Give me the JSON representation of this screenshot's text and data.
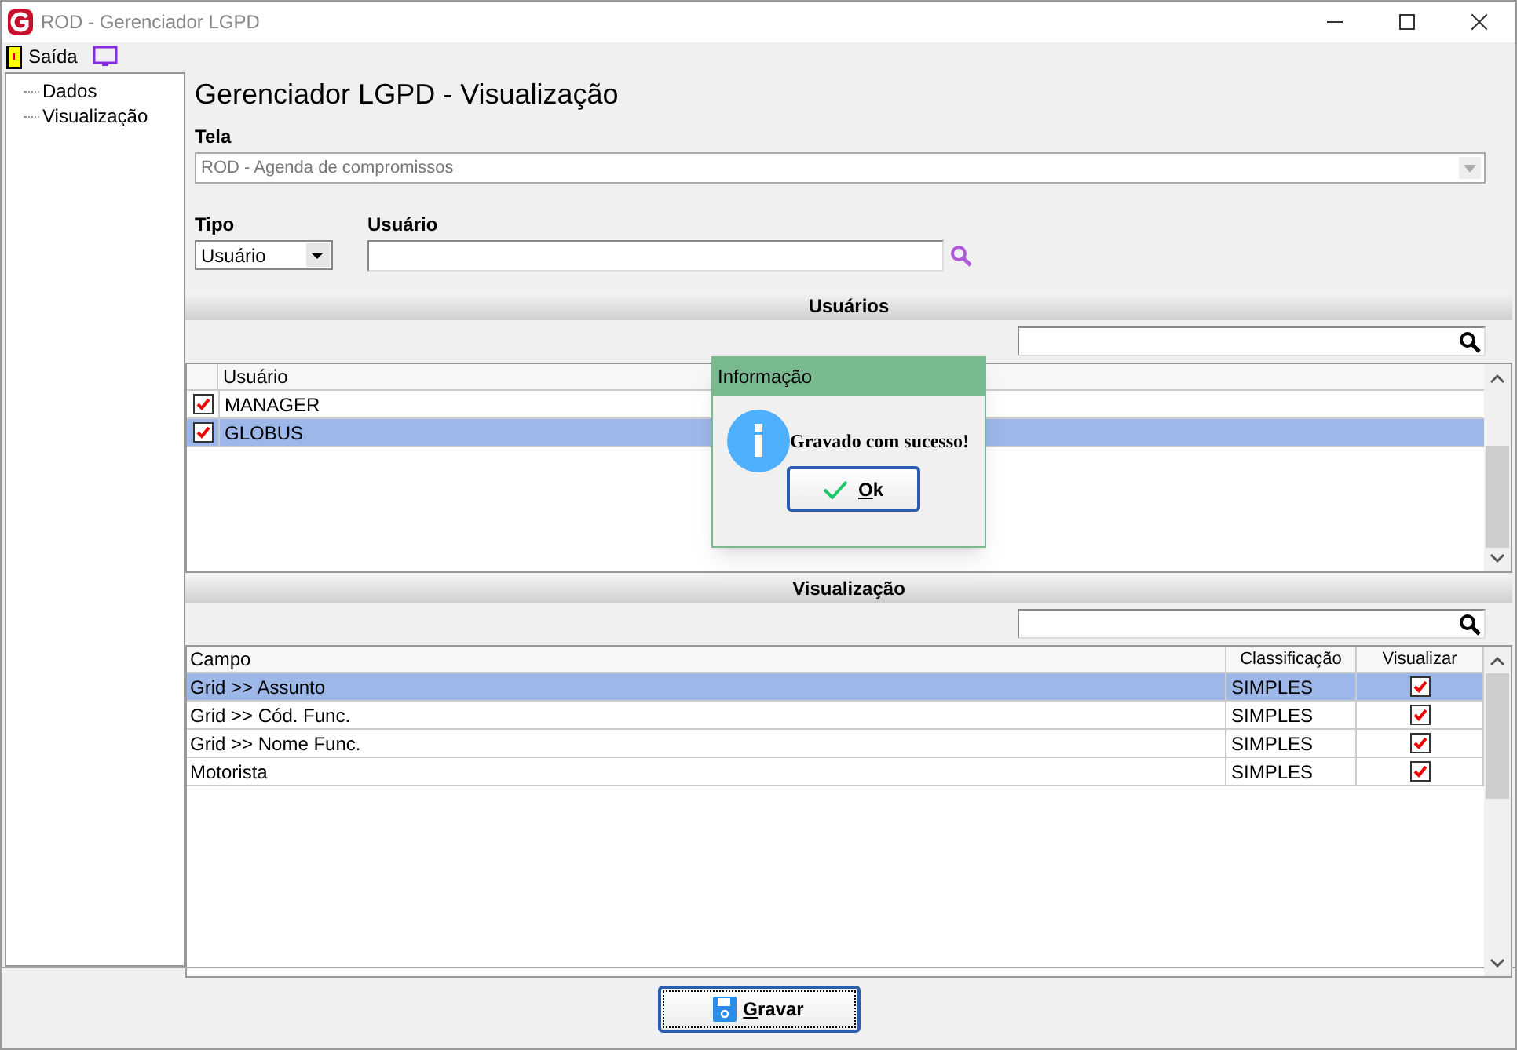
{
  "window": {
    "title": "ROD - Gerenciador LGPD"
  },
  "toolbar": {
    "exit_label": "Saída"
  },
  "tree": {
    "items": [
      {
        "label": "Dados"
      },
      {
        "label": "Visualização"
      }
    ]
  },
  "heading": "Gerenciador LGPD - Visualização",
  "tela": {
    "label": "Tela",
    "value": "ROD - Agenda de compromissos"
  },
  "tipo": {
    "label": "Tipo",
    "value": "Usuário"
  },
  "usuario": {
    "label": "Usuário"
  },
  "users_section": {
    "title": "Usuários",
    "column": "Usuário",
    "rows": [
      {
        "name": "MANAGER",
        "checked": true,
        "selected": false
      },
      {
        "name": "GLOBUS",
        "checked": true,
        "selected": true
      }
    ]
  },
  "fields_section": {
    "title": "Visualização",
    "columns": [
      "Campo",
      "Classificação",
      "Visualizar"
    ],
    "rows": [
      {
        "campo": "Grid >> Assunto",
        "classificacao": "SIMPLES",
        "visualizar": true,
        "selected": true
      },
      {
        "campo": "Grid >> Cód. Func.",
        "classificacao": "SIMPLES",
        "visualizar": true,
        "selected": false
      },
      {
        "campo": "Grid >> Nome Func.",
        "classificacao": "SIMPLES",
        "visualizar": true,
        "selected": false
      },
      {
        "campo": "Motorista",
        "classificacao": "SIMPLES",
        "visualizar": true,
        "selected": false
      }
    ]
  },
  "dialog": {
    "title": "Informação",
    "message": "Gravado com sucesso!",
    "button": "Ok"
  },
  "save_button": "Gravar"
}
